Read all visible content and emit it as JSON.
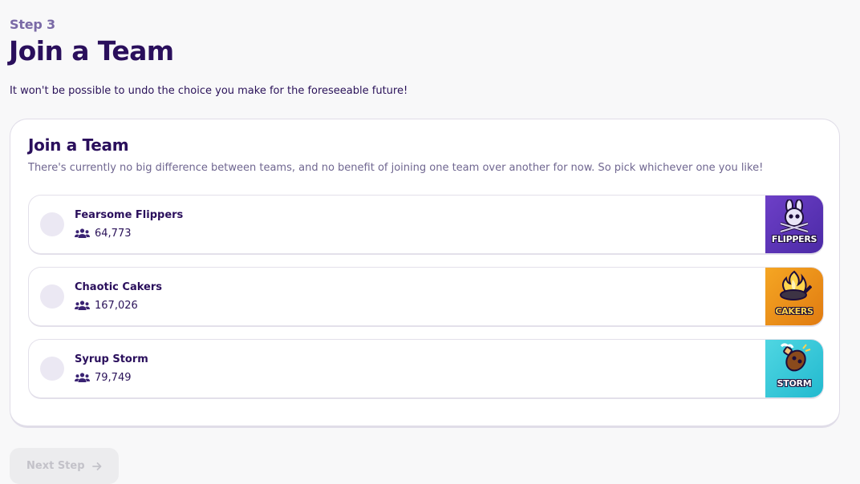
{
  "header": {
    "step_label": "Step 3",
    "title": "Join a Team",
    "subtitle": "It won't be possible to undo the choice you make for the foreseeable future!"
  },
  "card": {
    "title": "Join a Team",
    "description": "There's currently no big difference between teams, and no benefit of joining one team over another for now. So pick whichever one you like!"
  },
  "teams": [
    {
      "name": "Fearsome Flippers",
      "members": "64,773",
      "logo_text": "FLIPPERS",
      "logo_color": "#5b33b8",
      "selected": false
    },
    {
      "name": "Chaotic Cakers",
      "members": "167,026",
      "logo_text": "CAKERS",
      "logo_color": "#f0951c",
      "selected": false
    },
    {
      "name": "Syrup Storm",
      "members": "79,749",
      "logo_text": "STORM",
      "logo_color": "#34c8d8",
      "selected": false
    }
  ],
  "footer": {
    "next_label": "Next Step",
    "next_icon": "arrow-right-icon",
    "next_enabled": false
  },
  "colors": {
    "primary_text": "#2a0f5c",
    "muted_text": "#6f6690",
    "background": "#f8f8f9"
  }
}
